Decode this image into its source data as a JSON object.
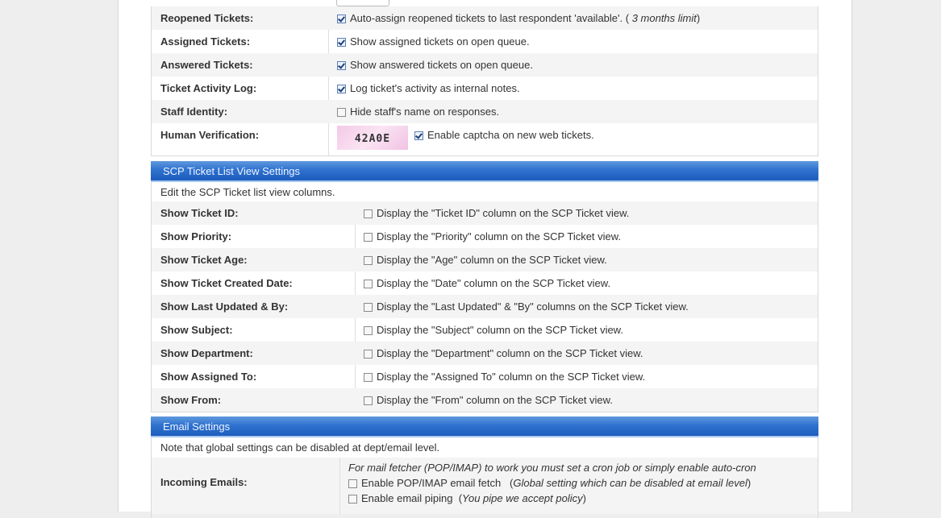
{
  "ticket_settings": {
    "rows": [
      {
        "label": "Reopened Tickets:",
        "text": "Auto-assign reopened tickets to last respondent 'available'. (",
        "italic": "3 months limit",
        "text_after": ")",
        "checked": true
      },
      {
        "label": "Assigned Tickets:",
        "text": "Show assigned tickets on open queue.",
        "checked": true
      },
      {
        "label": "Answered Tickets:",
        "text": "Show answered tickets on open queue.",
        "checked": true
      },
      {
        "label": "Ticket Activity Log:",
        "text": "Log ticket's activity as internal notes.",
        "checked": true
      },
      {
        "label": "Staff Identity:",
        "text": "Hide staff's name on responses.",
        "checked": false
      }
    ],
    "human_verification": {
      "label": "Human Verification:",
      "captcha_text": "42A0E",
      "text": "Enable captcha on new web tickets.",
      "checked": true
    }
  },
  "scp_section": {
    "title": "SCP Ticket List View Settings",
    "note": "Edit the SCP Ticket list view columns.",
    "rows": [
      {
        "label": "Show Ticket ID:",
        "text": "Display the \"Ticket ID\" column on the SCP Ticket view.",
        "checked": false
      },
      {
        "label": "Show Priority:",
        "text": "Display the \"Priority\" column on the SCP Ticket view.",
        "checked": false
      },
      {
        "label": "Show Ticket Age:",
        "text": "Display the \"Age\" column on the SCP Ticket view.",
        "checked": false
      },
      {
        "label": "Show Ticket Created Date:",
        "text": "Display the \"Date\" column on the SCP Ticket view.",
        "checked": false
      },
      {
        "label": "Show Last Updated & By:",
        "text": "Display the \"Last Updated\" & \"By\" columns on the SCP Ticket view.",
        "checked": false
      },
      {
        "label": "Show Subject:",
        "text": "Display the \"Subject\" column on the SCP Ticket view.",
        "checked": false
      },
      {
        "label": "Show Department:",
        "text": "Display the \"Department\" column on the SCP Ticket view.",
        "checked": false
      },
      {
        "label": "Show Assigned To:",
        "text": "Display the \"Assigned To\" column on the SCP Ticket view.",
        "checked": false
      },
      {
        "label": "Show From:",
        "text": "Display the \"From\" column on the SCP Ticket view.",
        "checked": false
      }
    ]
  },
  "email_section": {
    "title": "Email Settings",
    "note": "Note that global settings can be disabled at dept/email level.",
    "incoming": {
      "label": "Incoming Emails:",
      "hint": "For mail fetcher (POP/IMAP) to work you must set a cron job or simply enable auto-cron",
      "fetch_text": "Enable POP/IMAP email fetch",
      "fetch_note": "Global setting which can be disabled at email level",
      "piping_text": "Enable email piping",
      "piping_note": "You pipe we accept policy",
      "fetch_checked": false,
      "piping_checked": false
    }
  }
}
